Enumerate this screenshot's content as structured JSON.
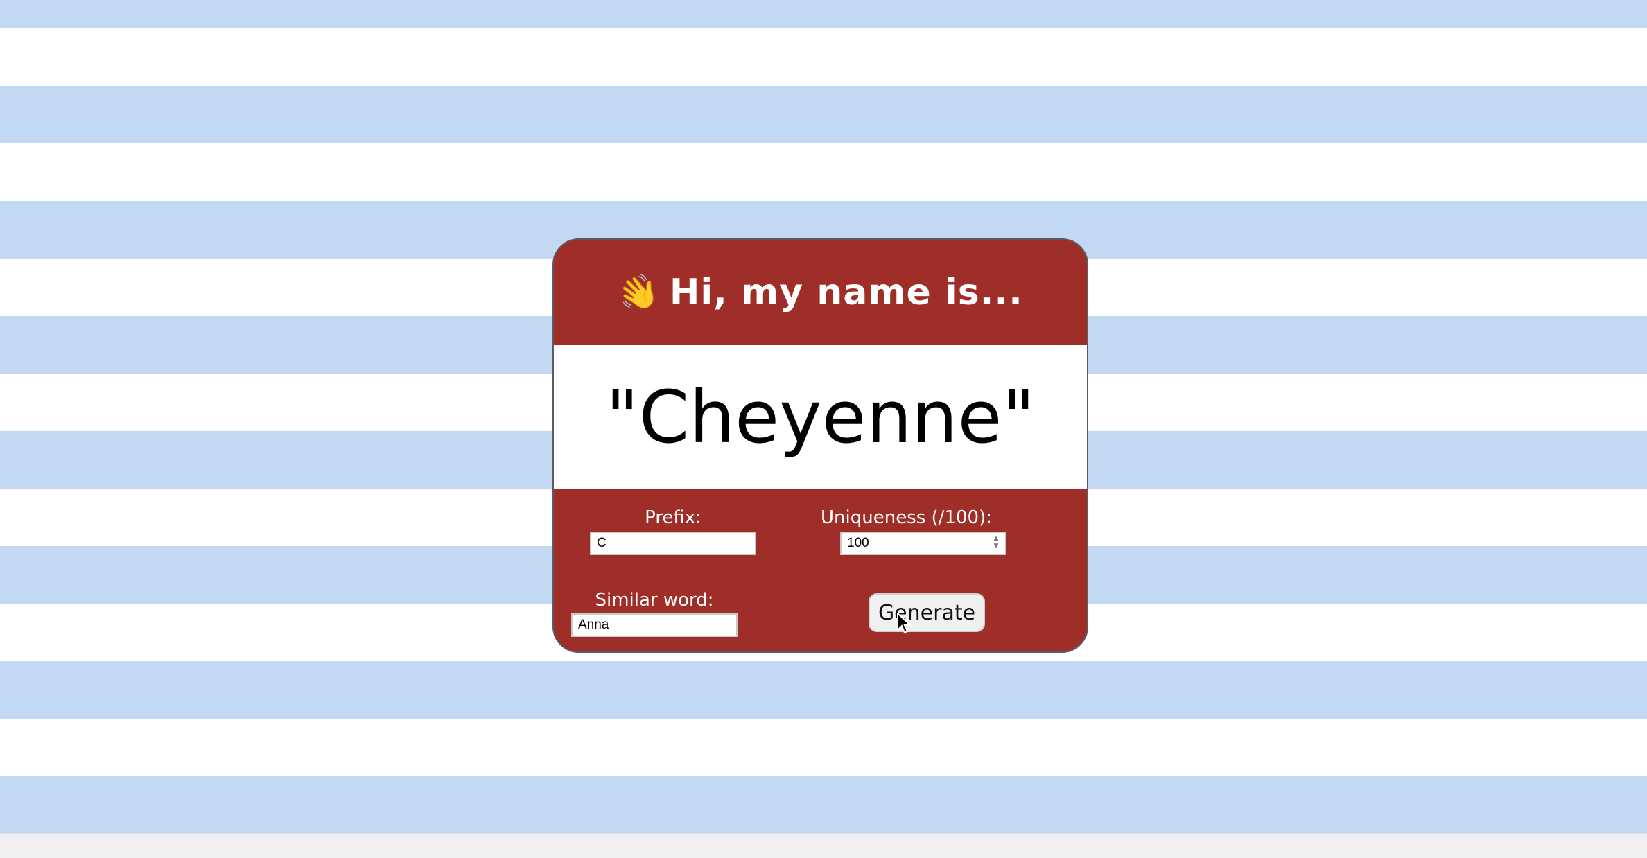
{
  "header": {
    "wave_icon": "👋",
    "title": "Hi, my name is..."
  },
  "name_display": {
    "value": "\"Cheyenne\""
  },
  "form": {
    "prefix_label": "Prefix:",
    "prefix_value": "C",
    "uniqueness_label": "Uniqueness (/100):",
    "uniqueness_value": "100",
    "similar_label": "Similar word:",
    "similar_value": "Anna",
    "generate_label": "Generate"
  },
  "colors": {
    "card_red": "#9e2e27",
    "stripe_blue": "#c3d9f3"
  }
}
